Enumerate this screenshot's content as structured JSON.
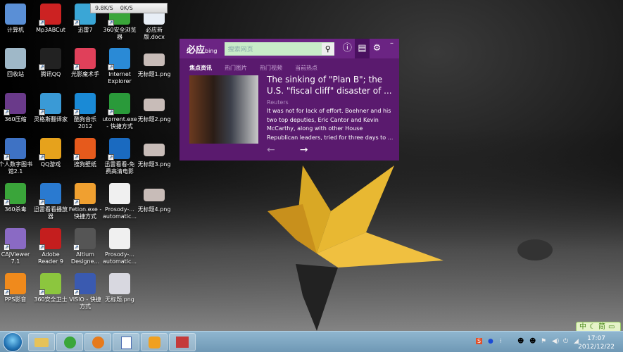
{
  "desktop": {
    "icons": [
      {
        "label": "计算机",
        "color": "#5a8fd6",
        "shortcut": false
      },
      {
        "label": "回收站",
        "color": "#9fb8c8",
        "shortcut": false
      },
      {
        "label": "360压缩",
        "color": "#6a3a8a",
        "shortcut": true
      },
      {
        "label": "个人数字图书馆2.1",
        "color": "#3e72c4",
        "shortcut": true
      },
      {
        "label": "360杀毒",
        "color": "#3aa53a",
        "shortcut": true
      },
      {
        "label": "CAJViewer 7.1",
        "color": "#8a6ac4",
        "shortcut": true
      },
      {
        "label": "PPS影音",
        "color": "#f08a1c",
        "shortcut": true
      },
      {
        "label": "Mp3ABCut",
        "color": "#cc2222",
        "shortcut": true
      },
      {
        "label": "腾讯QQ",
        "color": "#222222",
        "shortcut": true
      },
      {
        "label": "灵格斯翻译家",
        "color": "#3a9ad6",
        "shortcut": true
      },
      {
        "label": "QQ游戏",
        "color": "#e6a21c",
        "shortcut": true
      },
      {
        "label": "迅雷看看播放器",
        "color": "#2a7ad0",
        "shortcut": true
      },
      {
        "label": "Adobe Reader 9",
        "color": "#c41e1e",
        "shortcut": true
      },
      {
        "label": "360安全卫士",
        "color": "#8cc63e",
        "shortcut": true
      },
      {
        "label": "迅雷7",
        "color": "#3aa6d6",
        "shortcut": true
      },
      {
        "label": "光影魔术手",
        "color": "#e0405a",
        "shortcut": true
      },
      {
        "label": "酷狗音乐2012",
        "color": "#1a8ad6",
        "shortcut": true
      },
      {
        "label": "搜狗壁纸",
        "color": "#e65a1c",
        "shortcut": true
      },
      {
        "label": "Fetion.exe - 快捷方式",
        "color": "#f0a030",
        "shortcut": true
      },
      {
        "label": "Altium Designe...",
        "color": "#555555",
        "shortcut": true
      },
      {
        "label": "VISIO - 快捷方式",
        "color": "#3a5ab0",
        "shortcut": true
      },
      {
        "label": "360安全浏览器",
        "color": "#3aa63a",
        "shortcut": true
      },
      {
        "label": "Internet Explorer",
        "color": "#2a8ad6",
        "shortcut": true
      },
      {
        "label": "utorrent.exe - 快捷方式",
        "color": "#2a9a3a",
        "shortcut": true
      },
      {
        "label": "迅雷看看-免费高清电影",
        "color": "#1a6ac0",
        "shortcut": true
      },
      {
        "label": "Prosody-... automatic...",
        "color": "#f0f0f0",
        "shortcut": false
      },
      {
        "label": "Prosody-... automatic...",
        "color": "#f0f0f0",
        "shortcut": false
      },
      {
        "label": "无标题.png",
        "color": "#d8d8e0",
        "shortcut": false
      },
      {
        "label": "必应新版.docx",
        "color": "#e8eef6",
        "shortcut": false
      },
      {
        "label": "无标题1.png",
        "color": "#c8bcb8",
        "shortcut": false
      },
      {
        "label": "无标题2.png",
        "color": "#c8bcb8",
        "shortcut": false
      },
      {
        "label": "无标题3.png",
        "color": "#c8bcb8",
        "shortcut": false
      },
      {
        "label": "无标题4.png",
        "color": "#c8bcb8",
        "shortcut": false
      }
    ]
  },
  "netspeed": {
    "down": "9.8K/S",
    "up": "0K/S"
  },
  "bing": {
    "logo": "必应",
    "logo_sub": "bing",
    "search_placeholder": "搜索网页",
    "tabs": [
      "焦点资讯",
      "热门图片",
      "热门视频",
      "当前热点"
    ],
    "article": {
      "title": "The sinking of \"Plan B\"; the U.S. \"fiscal cliff\" disaster of ...",
      "source": "Reuters",
      "description": "It was not for lack of effort. Boehner and his two top deputies, Eric Cantor and Kevin McCarthy, along with other House Republican leaders, tried for three days to ..."
    },
    "prev": "←",
    "next": "→",
    "minimize": "–"
  },
  "ime": {
    "lang": "中",
    "mode": "简"
  },
  "taskbar": {
    "time": "17:07",
    "date": "2012/12/22",
    "pinned": [
      "windows-explorer",
      "360-browser",
      "media-player",
      "word-document",
      "bing-desktop",
      "image-viewer"
    ]
  }
}
